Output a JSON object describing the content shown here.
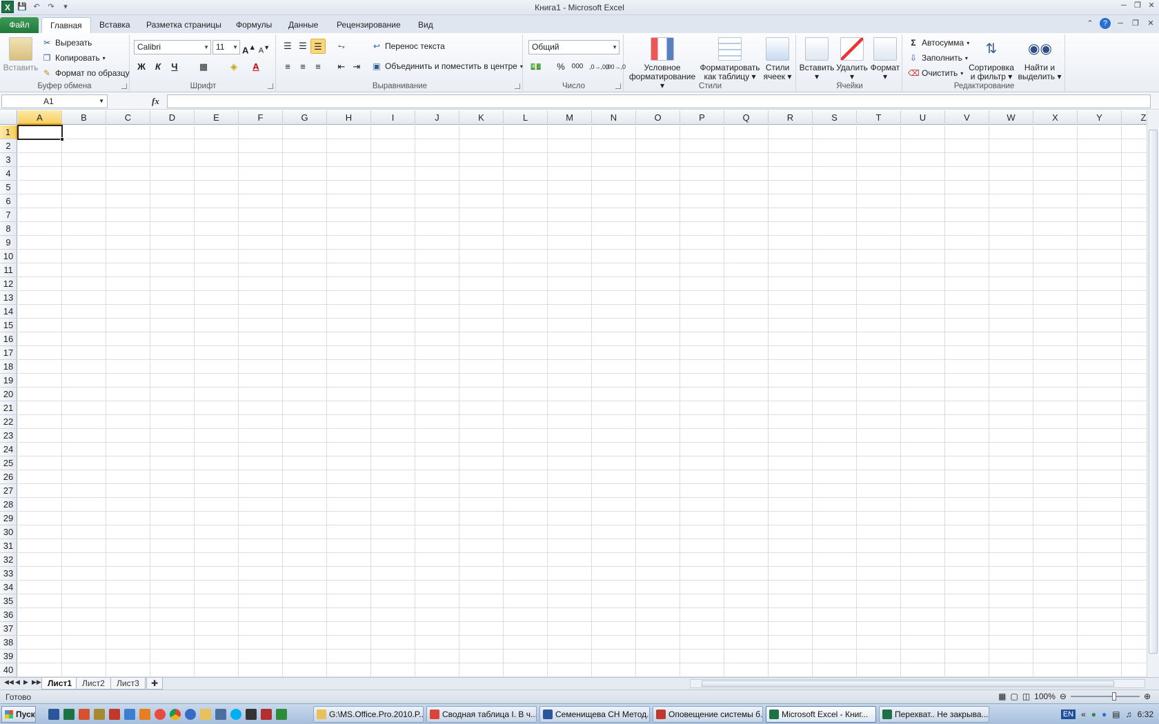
{
  "window": {
    "title": "Книга1  -  Microsoft Excel"
  },
  "tabs": [
    {
      "label": "Файл"
    },
    {
      "label": "Главная"
    },
    {
      "label": "Вставка"
    },
    {
      "label": "Разметка страницы"
    },
    {
      "label": "Формулы"
    },
    {
      "label": "Данные"
    },
    {
      "label": "Рецензирование"
    },
    {
      "label": "Вид"
    }
  ],
  "clipboard": {
    "paste": "Вставить",
    "cut": "Вырезать",
    "copy": "Копировать",
    "format_painter": "Формат по образцу",
    "label": "Буфер обмена"
  },
  "font": {
    "name": "Calibri",
    "size": "11",
    "bold": "Ж",
    "italic": "К",
    "underline": "Ч",
    "grow": "A",
    "shrink": "A",
    "label": "Шрифт"
  },
  "alignment": {
    "wrap": "Перенос текста",
    "merge": "Объединить и поместить в центре",
    "label": "Выравнивание"
  },
  "number": {
    "format": "Общий",
    "percent": "%",
    "thousands": "000",
    "inc": ",0→,00",
    "dec": ",00→,0",
    "label": "Число"
  },
  "styles": {
    "conditional_1": "Условное",
    "conditional_2": "форматирование",
    "table_1": "Форматировать",
    "table_2": "как таблицу",
    "cell_1": "Стили",
    "cell_2": "ячеек",
    "label": "Стили"
  },
  "cells": {
    "insert": "Вставить",
    "delete": "Удалить",
    "format": "Формат",
    "label": "Ячейки"
  },
  "editing": {
    "autosum": "Автосумма",
    "fill": "Заполнить",
    "clear": "Очистить",
    "sort_1": "Сортировка",
    "sort_2": "и фильтр",
    "find_1": "Найти и",
    "find_2": "выделить",
    "label": "Редактирование"
  },
  "formula_bar": {
    "name_box": "A1",
    "fx": "fx",
    "value": ""
  },
  "columns": [
    "A",
    "B",
    "C",
    "D",
    "E",
    "F",
    "G",
    "H",
    "I",
    "J",
    "K",
    "L",
    "M",
    "N",
    "O",
    "P",
    "Q",
    "R",
    "S",
    "T",
    "U",
    "V",
    "W",
    "X",
    "Y",
    "Z"
  ],
  "rows": [
    "1",
    "2",
    "3",
    "4",
    "5",
    "6",
    "7",
    "8",
    "9",
    "10",
    "11",
    "12",
    "13",
    "14",
    "15",
    "16",
    "17",
    "18",
    "19",
    "20",
    "21",
    "22",
    "23",
    "24",
    "25",
    "26",
    "27",
    "28",
    "29",
    "30",
    "31",
    "32",
    "33",
    "34",
    "35",
    "36",
    "37",
    "38",
    "39",
    "40"
  ],
  "selected_cell": {
    "column": "A",
    "row": "1"
  },
  "sheets": [
    "Лист1",
    "Лист2",
    "Лист3"
  ],
  "status": {
    "ready": "Готово",
    "zoom": "100%"
  },
  "taskbar": {
    "start": "Пуск",
    "windows": [
      "G:\\MS.Office.Pro.2010.P...",
      "Сводная таблица I. В ч...",
      "Семенищева СН Метод...",
      "Оповещение системы б...",
      "Microsoft Excel - Книг...",
      "Перехват.. Не закрыва..."
    ],
    "lang": "EN",
    "clock": "6:32"
  }
}
